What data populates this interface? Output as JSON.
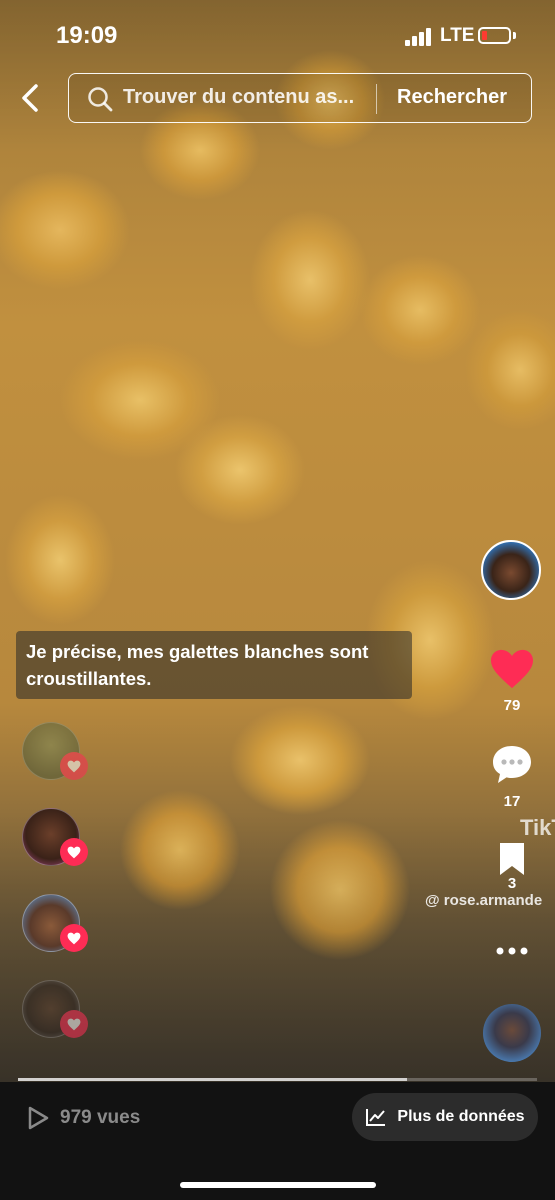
{
  "status_bar": {
    "time": "19:09",
    "network": "LTE",
    "battery_color": "#ff3b30"
  },
  "search": {
    "placeholder": "Trouver du contenu as...",
    "button_label": "Rechercher"
  },
  "caption": "Je précise, mes galettes blanches sont croustillantes.",
  "actions": {
    "like_count": "79",
    "comment_count": "17",
    "save_count": "3",
    "like_color": "#fe2c55"
  },
  "watermark": {
    "brand": "TikTo",
    "handle": "@ rose.armande"
  },
  "likers": [
    {
      "name": "liker-avatar-1",
      "style": "faded"
    },
    {
      "name": "liker-avatar-2",
      "style": "normal"
    },
    {
      "name": "liker-avatar-3",
      "style": "normal"
    },
    {
      "name": "liker-avatar-4",
      "style": "faded"
    }
  ],
  "playback": {
    "progress_fraction": 0.75
  },
  "bottom_bar": {
    "views": "979 vues",
    "data_button_label": "Plus de données"
  }
}
